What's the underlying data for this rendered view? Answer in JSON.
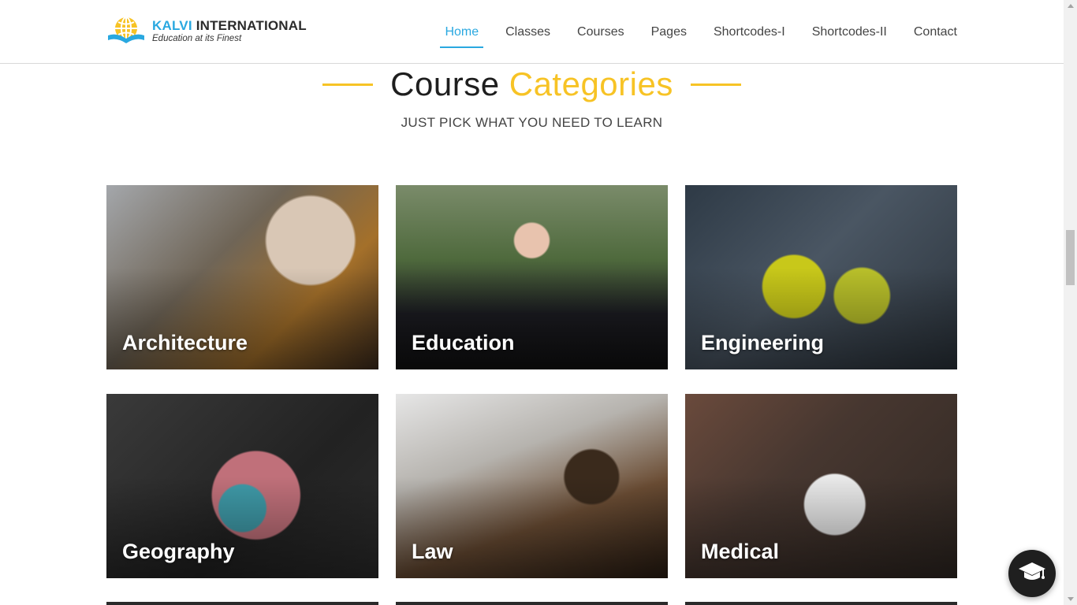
{
  "header": {
    "logo": {
      "brand_part1": "KALVI",
      "brand_part2": "INTERNATIONAL",
      "tagline": "Education at its Finest",
      "icon": "globe-book-icon"
    },
    "nav": [
      {
        "label": "Home",
        "active": true
      },
      {
        "label": "Classes"
      },
      {
        "label": "Courses"
      },
      {
        "label": "Pages"
      },
      {
        "label": "Shortcodes-I"
      },
      {
        "label": "Shortcodes-II"
      },
      {
        "label": "Contact"
      }
    ]
  },
  "section": {
    "title_part1": "Course",
    "title_part2": "Categories",
    "subtitle": "JUST PICK WHAT YOU NEED TO LEARN"
  },
  "categories": [
    {
      "label": "Architecture"
    },
    {
      "label": "Education"
    },
    {
      "label": "Engineering"
    },
    {
      "label": "Geography"
    },
    {
      "label": "Law"
    },
    {
      "label": "Medical"
    }
  ],
  "floating_button": {
    "icon": "graduation-cap-icon"
  },
  "colors": {
    "accent_blue": "#29a8e0",
    "accent_yellow": "#f7c325",
    "text_dark": "#1e1e1e"
  }
}
